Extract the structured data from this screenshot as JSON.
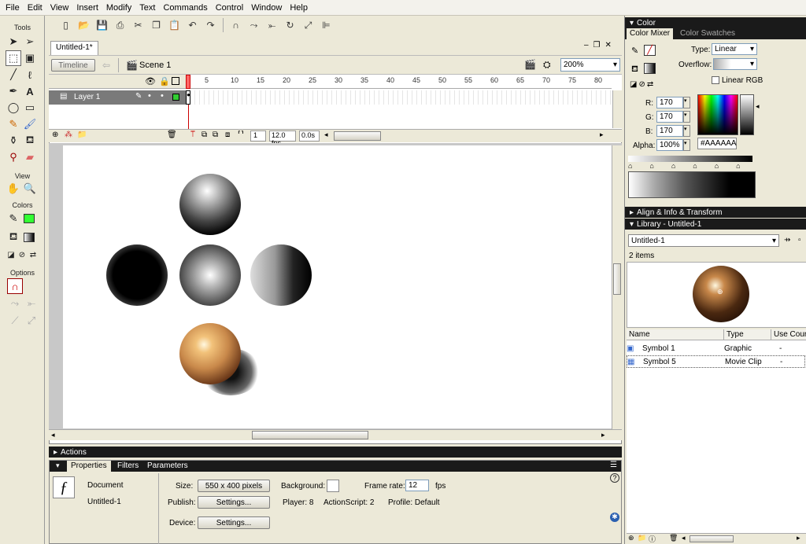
{
  "menu": [
    "File",
    "Edit",
    "View",
    "Insert",
    "Modify",
    "Text",
    "Commands",
    "Control",
    "Window",
    "Help"
  ],
  "tools": {
    "title": "Tools",
    "view_title": "View",
    "colors_title": "Colors",
    "options_title": "Options",
    "stroke_color": "#000000",
    "fill_color": "#33ff33"
  },
  "document": {
    "tab": "Untitled-1*",
    "timeline_button": "Timeline",
    "scene": "Scene 1",
    "zoom": "200%"
  },
  "timeline": {
    "layer": "Layer 1",
    "frames": [
      "5",
      "10",
      "15",
      "20",
      "25",
      "30",
      "35",
      "40",
      "45",
      "50",
      "55",
      "60",
      "65",
      "70",
      "75",
      "80"
    ],
    "current_frame": "1",
    "fps": "12.0 fps",
    "time": "0.0s"
  },
  "panels": {
    "actions": "Actions",
    "properties_tab": "Properties",
    "filters_tab": "Filters",
    "parameters_tab": "Parameters"
  },
  "properties": {
    "type": "Document",
    "name": "Untitled-1",
    "size_label": "Size:",
    "size_value": "550 x 400 pixels",
    "background_label": "Background:",
    "framerate_label": "Frame rate:",
    "framerate_value": "12",
    "fps_unit": "fps",
    "publish_label": "Publish:",
    "settings_button": "Settings...",
    "player": "Player: 8",
    "actionscript": "ActionScript:  2",
    "profile": "Profile:  Default",
    "device_label": "Device:",
    "device_button": "Settings..."
  },
  "color_panel": {
    "title": "Color",
    "tab_mixer": "Color Mixer",
    "tab_swatches": "Color Swatches",
    "type_label": "Type:",
    "type_value": "Linear",
    "overflow_label": "Overflow:",
    "linear_rgb": "Linear RGB",
    "r_label": "R:",
    "r_value": "170",
    "g_label": "G:",
    "g_value": "170",
    "b_label": "B:",
    "b_value": "170",
    "alpha_label": "Alpha:",
    "alpha_value": "100%",
    "hex_value": "#AAAAAA"
  },
  "align_panel": {
    "title": "Align & Info & Transform"
  },
  "library": {
    "title": "Library - Untitled-1",
    "doc": "Untitled-1",
    "count": "2 items",
    "columns": [
      "Name",
      "Type",
      "Use Cour"
    ],
    "items": [
      {
        "name": "Symbol 1",
        "type": "Graphic",
        "use": "-"
      },
      {
        "name": "Symbol 5",
        "type": "Movie Clip",
        "use": "-"
      }
    ]
  }
}
